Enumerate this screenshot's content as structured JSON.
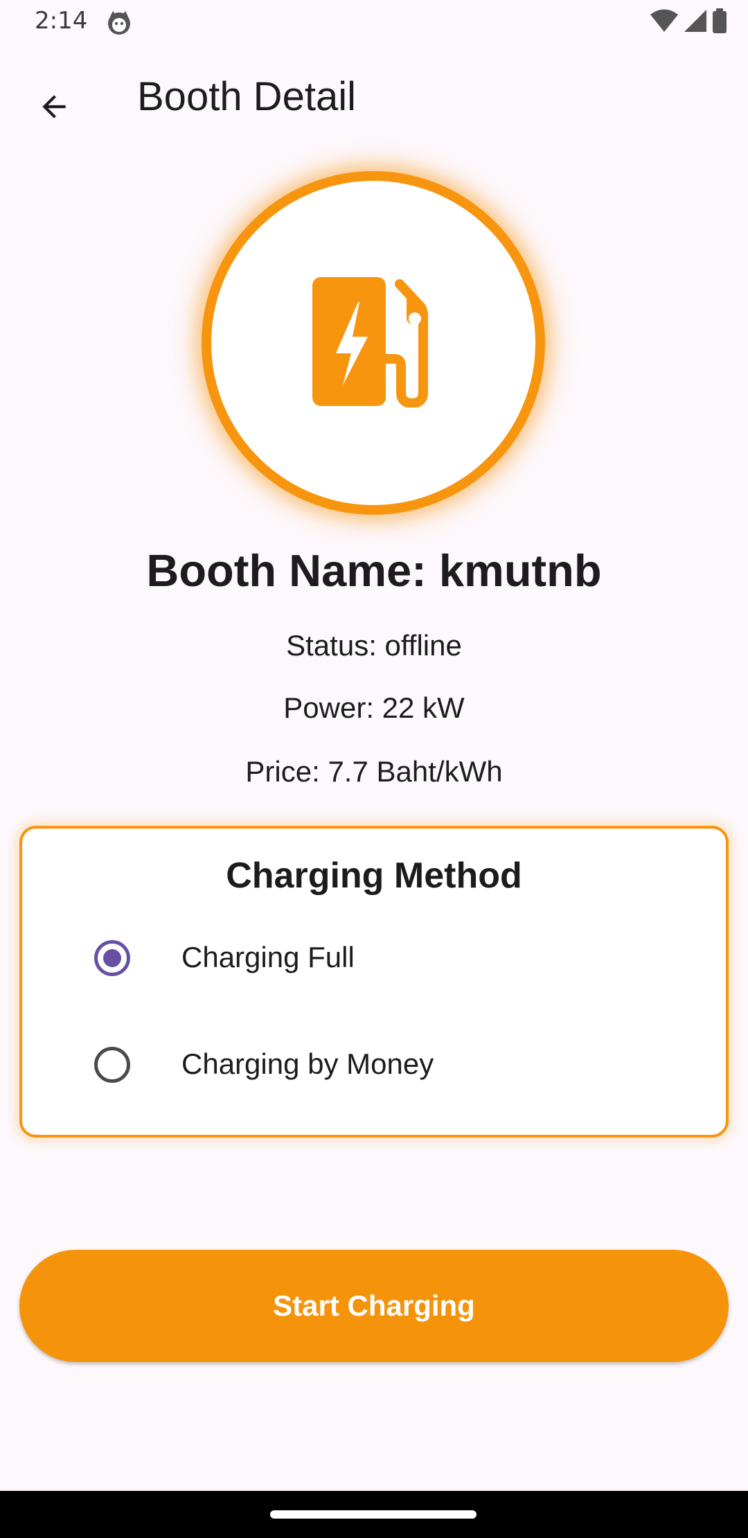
{
  "status_bar": {
    "time": "2:14",
    "icons": [
      "cat-notification-icon",
      "wifi-icon",
      "signal-icon",
      "battery-icon"
    ]
  },
  "app_bar": {
    "title": "Booth Detail",
    "back_icon": "arrow-back-icon"
  },
  "booth": {
    "icon": "ev-station-icon",
    "name": "Booth Name: kmutnb",
    "status": "Status: offline",
    "power": "Power: 22 kW",
    "price": "Price: 7.7 Baht/kWh"
  },
  "charging_method": {
    "title": "Charging Method",
    "options": [
      {
        "label": "Charging Full",
        "selected": true
      },
      {
        "label": "Charging by Money",
        "selected": false
      }
    ]
  },
  "actions": {
    "start_label": "Start Charging"
  },
  "colors": {
    "accent": "#f7950f",
    "radio_selected": "#6750a4",
    "background": "#fdf8fb"
  }
}
